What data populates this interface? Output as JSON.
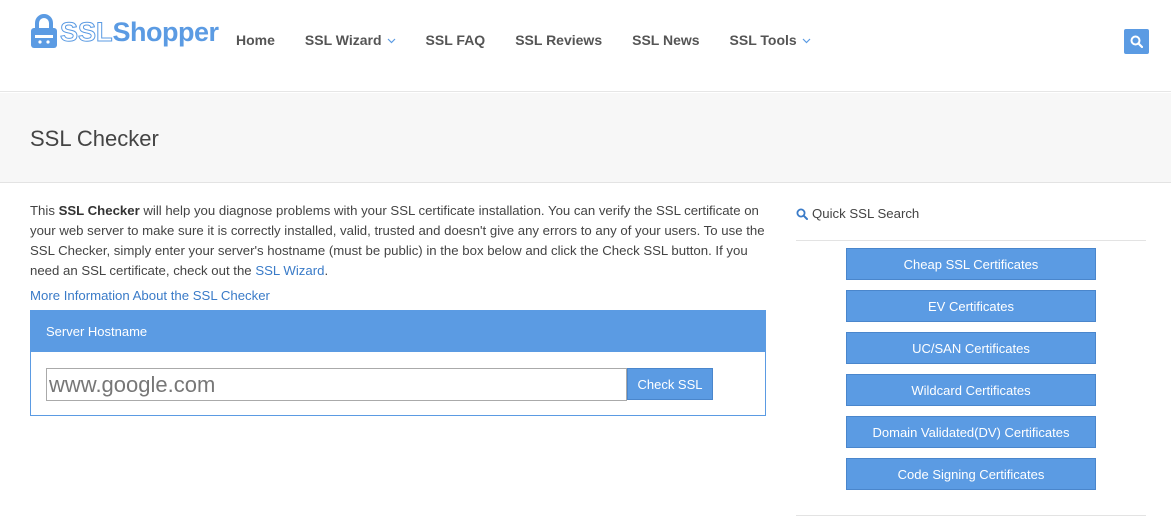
{
  "header": {
    "logo_ssl": "SSL",
    "logo_shopper": "Shopper",
    "nav": [
      {
        "label": "Home",
        "has_caret": false
      },
      {
        "label": "SSL Wizard",
        "has_caret": true
      },
      {
        "label": "SSL FAQ",
        "has_caret": false
      },
      {
        "label": "SSL Reviews",
        "has_caret": false
      },
      {
        "label": "SSL News",
        "has_caret": false
      },
      {
        "label": "SSL Tools",
        "has_caret": true
      }
    ]
  },
  "page": {
    "title": "SSL Checker"
  },
  "intro": {
    "prefix": "This ",
    "bold": "SSL Checker",
    "body": " will help you diagnose problems with your SSL certificate installation. You can verify the SSL certificate on your web server to make sure it is correctly installed, valid, trusted and doesn't give any errors to any of your users. To use the SSL Checker, simply enter your server's hostname (must be public) in the box below and click the Check SSL button. If you need an SSL certificate, check out the ",
    "link": "SSL Wizard",
    "suffix": "."
  },
  "more_info": "More Information About the SSL Checker",
  "checker": {
    "heading": "Server Hostname",
    "input_placeholder": "www.google.com",
    "button": "Check SSL"
  },
  "sidebar": {
    "heading": "Quick SSL Search",
    "buttons": [
      "Cheap SSL Certificates",
      "EV Certificates",
      "UC/SAN Certificates",
      "Wildcard Certificates",
      "Domain Validated(DV) Certificates",
      "Code Signing Certificates"
    ]
  },
  "colors": {
    "accent": "#5b9be3",
    "link": "#3a7bc8"
  }
}
